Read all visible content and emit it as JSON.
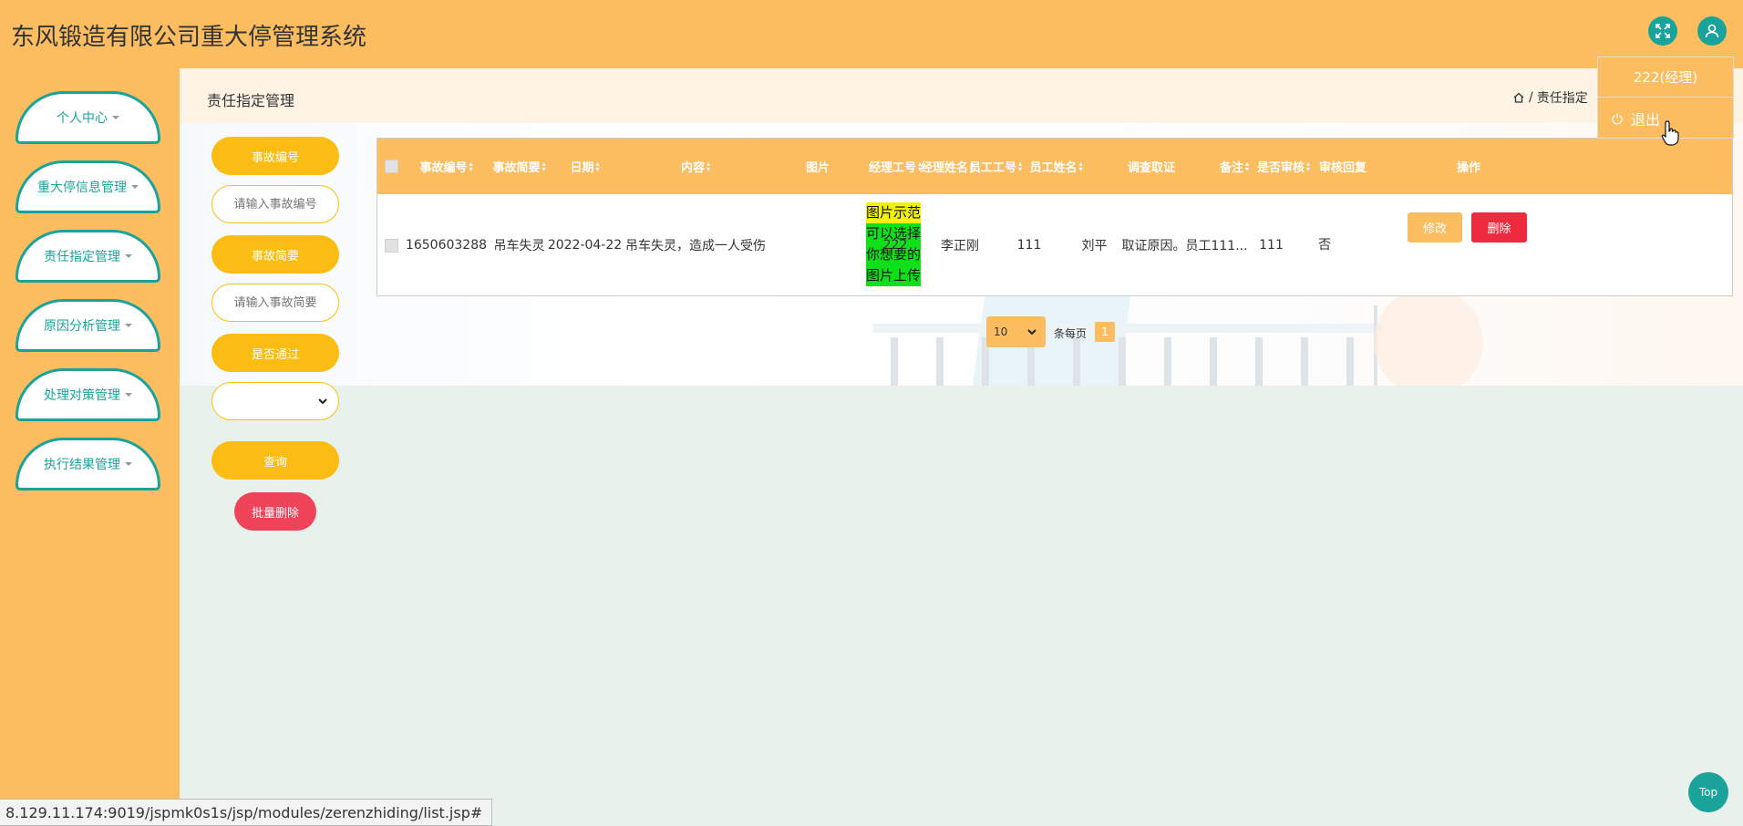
{
  "app": {
    "title": "东风锻造有限公司重大停管理系统"
  },
  "header": {
    "fullscreen_icon": "expand-icon",
    "user_icon": "user-icon"
  },
  "user_menu": {
    "user_label": "222(经理)",
    "logout_label": "退出",
    "logout_icon": "power-icon"
  },
  "sidebar": {
    "items": [
      {
        "label": "个人中心"
      },
      {
        "label": "重大停信息管理"
      },
      {
        "label": "责任指定管理"
      },
      {
        "label": "原因分析管理"
      },
      {
        "label": "处理对策管理"
      },
      {
        "label": "执行结果管理"
      }
    ]
  },
  "page": {
    "title": "责任指定管理",
    "breadcrumb_current": "责任指定"
  },
  "filters": {
    "accident_no_label": "事故编号",
    "accident_no_placeholder": "请输入事故编号",
    "summary_label": "事故简要",
    "summary_placeholder": "请输入事故简要",
    "passed_label": "是否通过",
    "passed_value": "",
    "query_label": "查询",
    "batch_delete_label": "批量删除"
  },
  "table": {
    "columns": [
      "事故编号",
      "事故简要",
      "日期",
      "内容",
      "图片",
      "经理工号",
      "经理姓名",
      "员工工号",
      "员工姓名",
      "调查取证",
      "备注",
      "是否审核",
      "审核回复",
      "操作"
    ],
    "rows": [
      {
        "accident_no": "1650603288",
        "summary": "吊车失灵",
        "date": "2022-04-22",
        "content": "吊车失灵，造成一人受伤",
        "image_lines": [
          "图片示范",
          "可以选择",
          "你想要的",
          "图片上传"
        ],
        "manager_id": "222",
        "manager_name": "李正刚",
        "employee_id": "111",
        "employee_name": "刘平",
        "investigation": "取证原因。员工111...",
        "remark": "111",
        "reviewed": "否",
        "review_reply": "",
        "edit_label": "修改",
        "delete_label": "删除"
      }
    ]
  },
  "pager": {
    "page_size": "10",
    "per_page_label": "条每页",
    "current_page": "1"
  },
  "status_url": "8.129.11.174:9019/jspmk0s1s/jsp/modules/zerenzhiding/list.jsp#",
  "top_button": "Top",
  "colors": {
    "primary": "#fbbd60",
    "teal": "#1aa39a",
    "pill": "#fbbd14",
    "danger": "#ee2a3e"
  }
}
